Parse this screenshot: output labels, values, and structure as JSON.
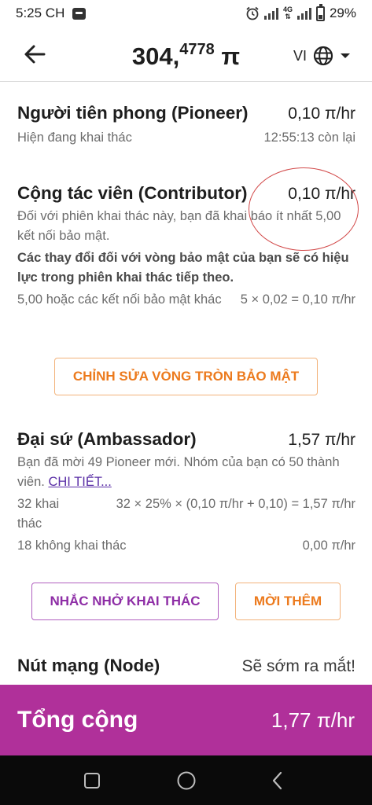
{
  "status_bar": {
    "time": "5:25 CH",
    "network": "4G",
    "battery": "29%"
  },
  "header": {
    "balance_int": "304,",
    "balance_frac": "4778",
    "balance_symbol": "π",
    "language": "VI"
  },
  "pioneer": {
    "title": "Người tiên phong (Pioneer)",
    "rate": "0,10 π/hr",
    "status": "Hiện đang khai thác",
    "time_left": "12:55:13 còn lại"
  },
  "contributor": {
    "title": "Cộng tác viên (Contributor)",
    "rate": "0,10 π/hr",
    "desc": "Đối với phiên khai thác này, bạn đã khai báo ít nhất 5,00 kết nối bảo mật.",
    "note": "Các thay đổi đối với vòng bảo mật của bạn sẽ có hiệu lực trong phiên khai thác tiếp theo.",
    "calc_label": "5,00 hoặc các kết nối bảo mật khác",
    "calc_value": "5 × 0,02 = 0,10 π/hr",
    "edit_button": "CHỈNH SỬA VÒNG TRÒN BẢO MẬT"
  },
  "ambassador": {
    "title": "Đại sứ (Ambassador)",
    "rate": "1,57 π/hr",
    "desc": "Bạn đã mời 49 Pioneer mới. Nhóm của bạn có 50 thành viên.",
    "details_link": "CHI TIẾT...",
    "mining_label": "32 khai thác",
    "mining_calc": "32 × 25% × (0,10 π/hr + 0,10) = 1,57 π/hr",
    "not_mining_label": "18 không khai thác",
    "not_mining_value": "0,00 π/hr",
    "remind_button": "NHẮC NHỞ KHAI THÁC",
    "invite_button": "MỜI THÊM"
  },
  "node": {
    "title": "Nút mạng (Node)",
    "status": "Sẽ sớm ra mắt!"
  },
  "total": {
    "label": "Tổng cộng",
    "value": "1,77 π/hr"
  },
  "colors": {
    "brand_purple": "#b0309a",
    "accent_orange": "#ec7a1d",
    "annotation_red": "#d24a4a"
  }
}
